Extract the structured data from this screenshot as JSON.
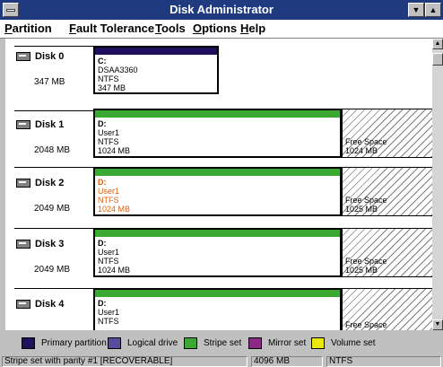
{
  "window": {
    "title": "Disk Administrator"
  },
  "menu": [
    {
      "u": "P",
      "rest": "artition"
    },
    {
      "u": "F",
      "rest": "ault Tolerance"
    },
    {
      "u": "T",
      "rest": "ools"
    },
    {
      "u": "O",
      "rest": "ptions"
    },
    {
      "u": "H",
      "rest": "elp"
    }
  ],
  "disks": [
    {
      "name": "Disk 0",
      "size": "347 MB",
      "partition": {
        "letter": "C:",
        "label": "DSAA3360",
        "fs": "NTFS",
        "size": "347 MB",
        "type": "primary",
        "highlight": false
      },
      "free": null
    },
    {
      "name": "Disk 1",
      "size": "2048 MB",
      "partition": {
        "letter": "D:",
        "label": "User1",
        "fs": "NTFS",
        "size": "1024 MB",
        "type": "stripe",
        "highlight": false
      },
      "free": {
        "label": "Free Space",
        "size": "1024 MB"
      }
    },
    {
      "name": "Disk 2",
      "size": "2049 MB",
      "partition": {
        "letter": "D:",
        "label": "User1",
        "fs": "NTFS",
        "size": "1024 MB",
        "type": "stripe",
        "highlight": true
      },
      "free": {
        "label": "Free Space",
        "size": "1025 MB"
      }
    },
    {
      "name": "Disk 3",
      "size": "2049 MB",
      "partition": {
        "letter": "D:",
        "label": "User1",
        "fs": "NTFS",
        "size": "1024 MB",
        "type": "stripe",
        "highlight": false
      },
      "free": {
        "label": "Free Space",
        "size": "1025 MB"
      }
    },
    {
      "name": "Disk 4",
      "size": "",
      "partition": {
        "letter": "D:",
        "label": "User1",
        "fs": "NTFS",
        "size": "",
        "type": "stripe",
        "highlight": false
      },
      "free": {
        "label": "Free Space",
        "size": ""
      }
    }
  ],
  "legend": [
    {
      "label": "Primary partition",
      "color": "#1f0f5c"
    },
    {
      "label": "Logical drive",
      "color": "#5a4aa0"
    },
    {
      "label": "Stripe set",
      "color": "#3aa832"
    },
    {
      "label": "Mirror set",
      "color": "#8a2a84"
    },
    {
      "label": "Volume set",
      "color": "#e8e80a"
    }
  ],
  "status": {
    "description": "Stripe set with parity #1  [RECOVERABLE]",
    "size": "4096 MB",
    "fs": "NTFS"
  },
  "colors": {
    "primary_head": "#1f0f5c",
    "stripe_head": "#3aa832",
    "highlight_text": "#e06010",
    "title_bar": "#203a80"
  }
}
